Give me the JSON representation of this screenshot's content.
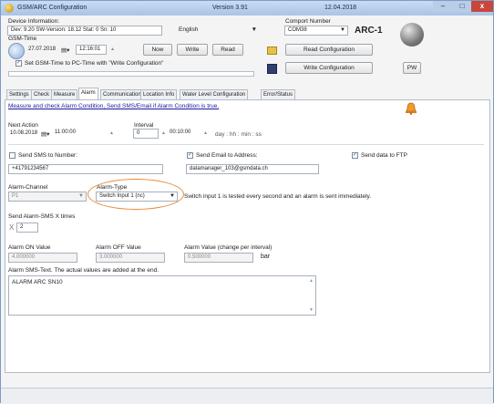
{
  "window": {
    "title": "GSM/ARC Configuration",
    "version": "Version 3.91",
    "date": "12.04.2018",
    "controls": [
      "–",
      "□",
      "x"
    ]
  },
  "device": {
    "info_label": "Device Information:",
    "info_value": "Dev: 9.20 SW-Version: 18.12 Stat: 0  Sn: 10",
    "language": "English",
    "gsm_time_label": "GSM-Time",
    "date": "27.07.2018",
    "time": "12:16:01",
    "now_button": "Now",
    "write_button": "Write",
    "read_button": "Read",
    "set_time_label": "Set GSM-Time to PC-Time with \"Write Configuration\"",
    "set_time_checked": true
  },
  "comport": {
    "label": "Comport Number",
    "value": "COM38",
    "device_name": "ARC-1",
    "read_config_button": "Read Configuration",
    "write_config_button": "Write Configuration",
    "pw_button": "PW"
  },
  "tabs": [
    "Settings",
    "Check",
    "Measure",
    "Alarm",
    "Communication",
    "Location Info",
    "Water Level Configuration",
    "Error/Status"
  ],
  "active_tab": "Alarm",
  "alarm": {
    "description": "Measure and check Alarm Condition, Send SMS/Email if Alarm Condition is true.",
    "next_action_label": "Next Action",
    "next_action_date": "10.08.2018",
    "next_action_time": "11:00:00",
    "interval_label": "Interval",
    "interval_days": "0",
    "interval_time": "00:10:00",
    "interval_units": "day : hh : min : ss",
    "send_sms_label": "Send SMS to Number:",
    "send_sms_checked": false,
    "sms_number": "+41791234567",
    "send_email_label": "Send Email to Address:",
    "send_email_checked": true,
    "email": "datamanager_103@gsmdata.ch",
    "send_ftp_label": "Send data to FTP",
    "send_ftp_checked": true,
    "channel_label": "Alarm-Channel",
    "channel_value": "P1",
    "type_label": "Alarm-Type",
    "type_value": "Switch Input 1 (nc)",
    "type_info": "Switch input 1 is tested every second and an alarm is sent immediately.",
    "sms_times_label": "Send Alarm-SMS X times",
    "sms_times_prefix": "X",
    "sms_times_value": "2",
    "on_label": "Alarm ON Value",
    "on_value": "4.000000",
    "off_label": "Alarm OFF Value",
    "off_value": "3.000000",
    "change_label": "Alarm Value (change per interval)",
    "change_value": "0.500000",
    "unit": "bar",
    "sms_text_label": "Alarm SMS-Text. The actual values are added at the end.",
    "sms_text": "ALARM ARC SN10"
  }
}
